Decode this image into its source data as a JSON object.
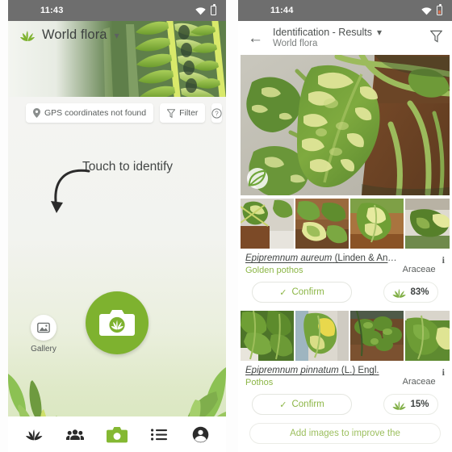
{
  "left_phone": {
    "status_bar": {
      "time": "11:43",
      "wifi_icon": "wifi-icon",
      "battery_icon": "battery-icon"
    },
    "app_bar": {
      "leaf_icon": "leaf-logo-icon",
      "title": "World flora",
      "chevron_icon": "chevron-down-icon"
    },
    "chips": [
      {
        "icon": "location-pin-icon",
        "label": "GPS coordinates not found"
      },
      {
        "icon": "filter-funnel-icon",
        "label": "Filter"
      },
      {
        "icon": "help-circle-icon",
        "label": ""
      }
    ],
    "hint": {
      "text": "Touch to identify",
      "arrow_icon": "curved-arrow-icon"
    },
    "shutter": {
      "icon": "camera-leaf-icon",
      "color": "#7eb22f"
    },
    "gallery": {
      "icon": "image-icon",
      "label": "Gallery"
    },
    "bottom_nav": [
      {
        "icon": "plant-leaf-icon",
        "label": "",
        "active": false
      },
      {
        "icon": "people-group-icon",
        "label": "",
        "active": false
      },
      {
        "icon": "camera-icon",
        "label": "",
        "active": true
      },
      {
        "icon": "list-icon",
        "label": "",
        "active": false
      },
      {
        "icon": "account-circle-icon",
        "label": "",
        "active": false
      }
    ]
  },
  "right_phone": {
    "status_bar": {
      "time": "11:44",
      "wifi_icon": "wifi-icon",
      "battery_icon": "battery-low-icon"
    },
    "app_bar": {
      "back_icon": "arrow-back-icon",
      "title": "Identification - Results",
      "chevron_icon": "chevron-down-icon",
      "subtitle": "World flora",
      "filter_icon": "filter-funnel-icon"
    },
    "query_photo": {
      "badge_icon": "plantnet-leaf-badge-icon"
    },
    "results": [
      {
        "scientific_name": "Epipremnum aureum",
        "authority": "(Linden & André) G.S…",
        "common_name": "Golden pothos",
        "family": "Araceae",
        "info_icon": "info-icon",
        "confirm_label": "Confirm",
        "confirm_icon": "check-icon",
        "score": "83%",
        "score_icon": "leaf-score-icon",
        "thumbnails": 4
      },
      {
        "scientific_name": "Epipremnum pinnatum",
        "authority": "(L.) Engl.",
        "common_name": "Pothos",
        "family": "Araceae",
        "info_icon": "info-icon",
        "confirm_label": "Confirm",
        "confirm_icon": "check-icon",
        "score": "15%",
        "score_icon": "leaf-score-icon",
        "thumbnails": 4
      }
    ],
    "add_images_label": "Add images to improve the"
  },
  "colors": {
    "brand_green": "#7eb22f",
    "accent_green": "#8cb646",
    "status_bar_gray": "#6e6e6e",
    "text_dark": "#3f4342",
    "text_muted": "#7c807f"
  }
}
